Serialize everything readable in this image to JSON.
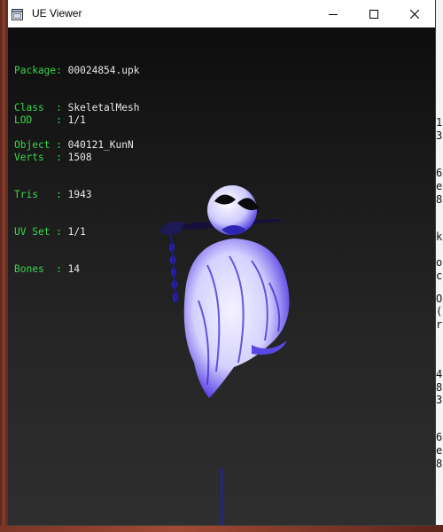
{
  "window": {
    "title": "UE Viewer"
  },
  "info_panel": {
    "object_info": [
      {
        "label": "Package",
        "value": "00024854.upk"
      },
      {
        "label": "Class  ",
        "value": "SkeletalMesh"
      },
      {
        "label": "Object ",
        "value": "040121_KunN"
      }
    ],
    "mesh_stats": [
      {
        "label": "LOD    ",
        "value": "1/1"
      },
      {
        "label": "Verts  ",
        "value": "1508"
      },
      {
        "label": "Tris   ",
        "value": "1943"
      },
      {
        "label": "UV Set ",
        "value": "1/1"
      },
      {
        "label": "Bones  ",
        "value": "14"
      }
    ]
  },
  "background_window_text": [
    "1",
    "3",
    "6",
    "e",
    "8",
    "k",
    "o",
    "c",
    "O",
    "(",
    "r",
    "4",
    "8",
    "3",
    "6",
    "e",
    "8"
  ],
  "colors": {
    "label_green": "#39d64a",
    "value_white": "#e8e8e8",
    "axis_blue": "#1a1ad8",
    "mesh_white": "#f0eeff",
    "mesh_blue": "#2a1bd0"
  },
  "icons": {
    "app": "window-icon",
    "minimize": "minimize-icon",
    "maximize": "maximize-icon",
    "close": "close-icon"
  }
}
